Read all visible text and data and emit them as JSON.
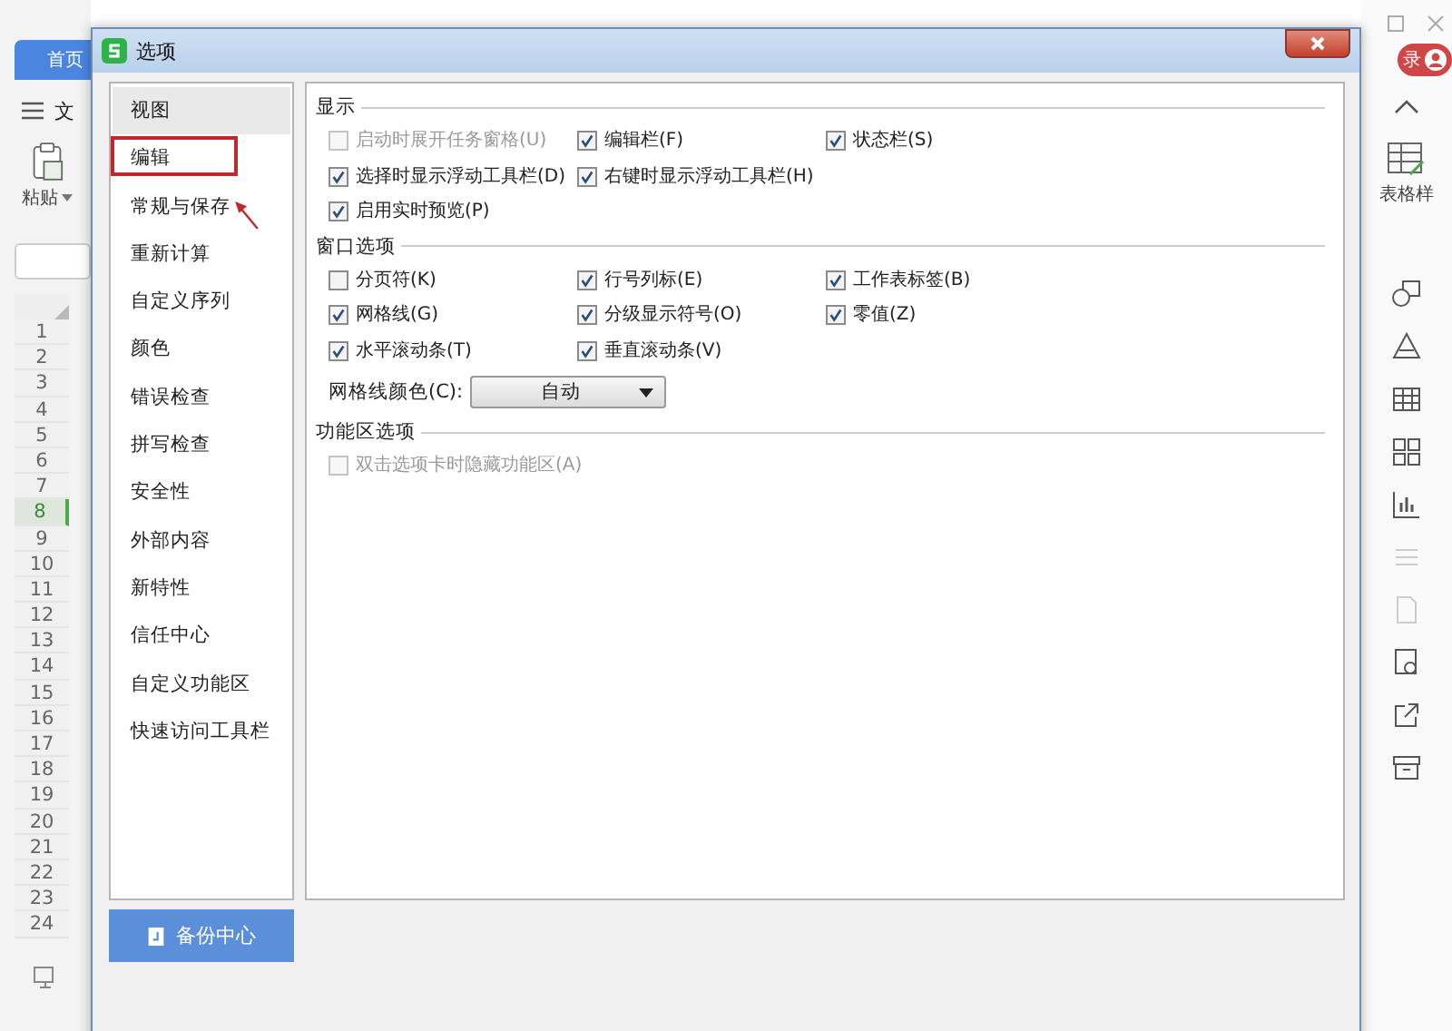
{
  "app": {
    "home_tab": "首页",
    "menu": "文",
    "paste": "粘贴",
    "table_style": "表格样",
    "login": "录",
    "rows": [
      {
        "label": "1",
        "selected": false
      },
      {
        "label": "2",
        "selected": false
      },
      {
        "label": "3",
        "selected": false
      },
      {
        "label": "4",
        "selected": false
      },
      {
        "label": "5",
        "selected": false
      },
      {
        "label": "6",
        "selected": false
      },
      {
        "label": "7",
        "selected": false
      },
      {
        "label": "8",
        "selected": true
      },
      {
        "label": "9",
        "selected": false
      },
      {
        "label": "10",
        "selected": false
      },
      {
        "label": "11",
        "selected": false
      },
      {
        "label": "12",
        "selected": false
      },
      {
        "label": "13",
        "selected": false
      },
      {
        "label": "14",
        "selected": false
      },
      {
        "label": "15",
        "selected": false
      },
      {
        "label": "16",
        "selected": false
      },
      {
        "label": "17",
        "selected": false
      },
      {
        "label": "18",
        "selected": false
      },
      {
        "label": "19",
        "selected": false
      },
      {
        "label": "20",
        "selected": false
      },
      {
        "label": "21",
        "selected": false
      },
      {
        "label": "22",
        "selected": false
      },
      {
        "label": "23",
        "selected": false
      },
      {
        "label": "24",
        "selected": false
      }
    ]
  },
  "dialog": {
    "title": "选项",
    "nav": [
      {
        "label": "视图",
        "selected": true,
        "marked": false,
        "pointed": false
      },
      {
        "label": "编辑",
        "selected": false,
        "marked": true,
        "pointed": false
      },
      {
        "label": "常规与保存",
        "selected": false,
        "marked": false,
        "pointed": true
      },
      {
        "label": "重新计算",
        "selected": false,
        "marked": false,
        "pointed": false
      },
      {
        "label": "自定义序列",
        "selected": false,
        "marked": false,
        "pointed": false
      },
      {
        "label": "颜色",
        "selected": false,
        "marked": false,
        "pointed": false
      },
      {
        "label": "错误检查",
        "selected": false,
        "marked": false,
        "pointed": false
      },
      {
        "label": "拼写检查",
        "selected": false,
        "marked": false,
        "pointed": false
      },
      {
        "label": "安全性",
        "selected": false,
        "marked": false,
        "pointed": false
      },
      {
        "label": "外部内容",
        "selected": false,
        "marked": false,
        "pointed": false
      },
      {
        "label": "新特性",
        "selected": false,
        "marked": false,
        "pointed": false
      },
      {
        "label": "信任中心",
        "selected": false,
        "marked": false,
        "pointed": false
      },
      {
        "label": "自定义功能区",
        "selected": false,
        "marked": false,
        "pointed": false
      },
      {
        "label": "快速访问工具栏",
        "selected": false,
        "marked": false,
        "pointed": false
      }
    ],
    "backup_button": "备份中心",
    "sections": [
      {
        "title": "显示",
        "rows": [
          [
            {
              "label": "启动时展开任务窗格(U)",
              "checked": false,
              "disabled": true
            },
            {
              "label": "编辑栏(F)",
              "checked": true,
              "disabled": false
            },
            {
              "label": "状态栏(S)",
              "checked": true,
              "disabled": false
            }
          ],
          [
            {
              "label": "选择时显示浮动工具栏(D)",
              "checked": true,
              "disabled": false
            },
            {
              "label": "右键时显示浮动工具栏(H)",
              "checked": true,
              "disabled": false
            }
          ],
          [
            {
              "label": "启用实时预览(P)",
              "checked": true,
              "disabled": false
            }
          ]
        ]
      },
      {
        "title": "窗口选项",
        "rows": [
          [
            {
              "label": "分页符(K)",
              "checked": false,
              "disabled": false
            },
            {
              "label": "行号列标(E)",
              "checked": true,
              "disabled": false
            },
            {
              "label": "工作表标签(B)",
              "checked": true,
              "disabled": false
            }
          ],
          [
            {
              "label": "网格线(G)",
              "checked": true,
              "disabled": false
            },
            {
              "label": "分级显示符号(O)",
              "checked": true,
              "disabled": false
            },
            {
              "label": "零值(Z)",
              "checked": true,
              "disabled": false
            }
          ],
          [
            {
              "label": "水平滚动条(T)",
              "checked": true,
              "disabled": false
            },
            {
              "label": "垂直滚动条(V)",
              "checked": true,
              "disabled": false
            }
          ]
        ],
        "select": {
          "label": "网格线颜色(C):",
          "value": "自动"
        }
      },
      {
        "title": "功能区选项",
        "rows": [
          [
            {
              "label": "双击选项卡时隐藏功能区(A)",
              "checked": false,
              "disabled": true
            }
          ]
        ]
      }
    ]
  }
}
